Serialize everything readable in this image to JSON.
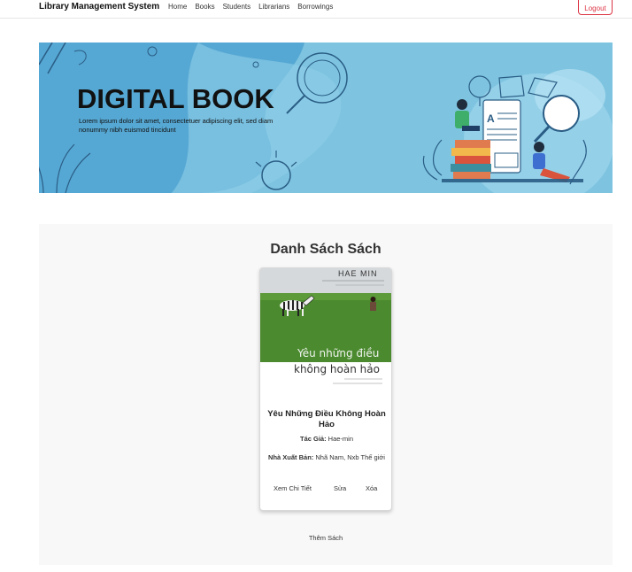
{
  "navbar": {
    "brand": "Library Management System",
    "links": [
      "Home",
      "Books",
      "Students",
      "Librarians",
      "Borrowings"
    ],
    "logout_label": "Logout"
  },
  "banner": {
    "title": "DIGITAL BOOK",
    "text": "Lorem ipsum dolor sit amet, consectetuer adipiscing elit, sed diam nonummy nibh euismod tincidunt"
  },
  "books_section": {
    "title": "Danh Sách Sách",
    "add_label": "Thêm Sách",
    "books": [
      {
        "cover": {
          "author_text": "HAE MIN",
          "title_line1": "Yêu những điều",
          "title_line2": "không hoàn hảo"
        },
        "title": "Yêu Những Điều Không Hoàn Hảo",
        "author_label": "Tác Giả:",
        "author": "Hae-min",
        "publisher_label": "Nhà Xuất Bản:",
        "publisher": "Nhã Nam, Nxb Thế giới",
        "actions": {
          "view": "Xem Chi Tiết",
          "edit": "Sửa",
          "delete": "Xóa"
        }
      }
    ]
  },
  "colors": {
    "banner_bg": "#7ec4e0",
    "banner_blob": "#4fa3d1",
    "logout": "#dc3545",
    "grass": "#4b8a2e",
    "sky": "#d5d9dc"
  }
}
